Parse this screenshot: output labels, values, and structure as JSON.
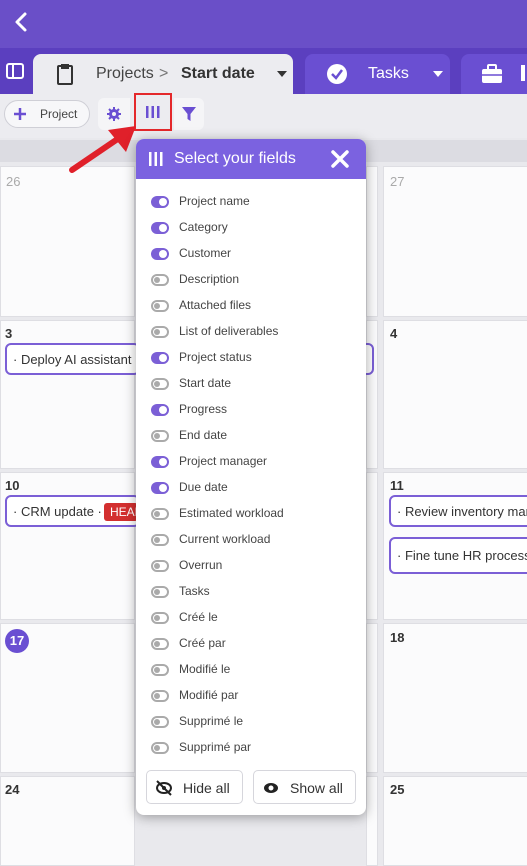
{
  "breadcrumb": {
    "root": "Projects",
    "separator": ">",
    "current": "Start date"
  },
  "tabs": {
    "tasks": "Tasks"
  },
  "toolbar": {
    "add_project_label": "Project"
  },
  "calendar": {
    "days": [
      "26",
      "27",
      "3",
      "4",
      "10",
      "11",
      "17",
      "18",
      "24",
      "25"
    ],
    "events": [
      "· Deploy AI assistant",
      "· CRM update ·",
      "· Review inventory man",
      "· Fine tune HR process"
    ],
    "badge": "HEAD"
  },
  "popup": {
    "title": "Select your fields",
    "fields": [
      {
        "label": "Project name",
        "on": true
      },
      {
        "label": "Category",
        "on": true
      },
      {
        "label": "Customer",
        "on": true
      },
      {
        "label": "Description",
        "on": false
      },
      {
        "label": "Attached files",
        "on": false
      },
      {
        "label": "List of deliverables",
        "on": false
      },
      {
        "label": "Project status",
        "on": true
      },
      {
        "label": "Start date",
        "on": false
      },
      {
        "label": "Progress",
        "on": true
      },
      {
        "label": "End date",
        "on": false
      },
      {
        "label": "Project manager",
        "on": true
      },
      {
        "label": "Due date",
        "on": true
      },
      {
        "label": "Estimated workload",
        "on": false
      },
      {
        "label": "Current workload",
        "on": false
      },
      {
        "label": "Overrun",
        "on": false
      },
      {
        "label": "Tasks",
        "on": false
      },
      {
        "label": "Créé le",
        "on": false
      },
      {
        "label": "Créé par",
        "on": false
      },
      {
        "label": "Modifié le",
        "on": false
      },
      {
        "label": "Modifié par",
        "on": false
      },
      {
        "label": "Supprimé le",
        "on": false
      },
      {
        "label": "Supprimé par",
        "on": false
      }
    ],
    "hide_all_label": "Hide all",
    "show_all_label": "Show all"
  },
  "colors": {
    "accent": "#6a4fc8",
    "highlight_box": "#e4282b",
    "badge": "#d32f2f"
  }
}
